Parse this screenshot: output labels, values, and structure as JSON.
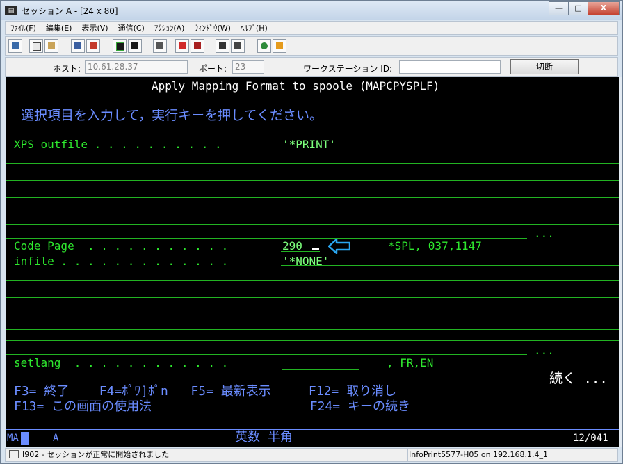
{
  "window": {
    "title": "セッション A - [24 x 80]",
    "buttons": {
      "minimize": "—",
      "maximize": "□",
      "close": "X"
    }
  },
  "menu": [
    "ﾌｧｲﾙ(F)",
    "編集(E)",
    "表示(V)",
    "通信(C)",
    "ｱｸｼｮﾝ(A)",
    "ｳｨﾝﾄﾞｳ(W)",
    "ﾍﾙﾌﾟ(H)"
  ],
  "toolbar_icons": [
    "print-screen-icon",
    "copy-icon",
    "paste-icon",
    "send-file-icon",
    "receive-file-icon",
    "display-icon",
    "keypad-icon",
    "macro-icon",
    "record-macro-icon",
    "stop-macro-icon",
    "play-macro-icon",
    "macro-list-icon",
    "network-icon",
    "support-icon"
  ],
  "connection": {
    "host_label": "ホスト:",
    "host_value": "10.61.28.37",
    "port_label": "ポート:",
    "port_value": "23",
    "ws_label": "ワークステーション ID:",
    "ws_value": "",
    "disconnect_label": "切断"
  },
  "terminal": {
    "title": "Apply Mapping Format to spoole (MAPCPYSPLF)",
    "instruction": "選択項目を入力して，実行キーを押してください。",
    "xps_label": "XPS outfile . . . . . . . . . .",
    "xps_value": "'*PRINT'",
    "more1": "...",
    "codepage_label": "Code Page  . . . . . . . . . . .",
    "codepage_value": "290",
    "codepage_hint": "*SPL, 037,1147",
    "infile_label": "infile . . . . . . . . . . . . .",
    "infile_value": "'*NONE'",
    "more2": "...",
    "setlang_label": "setlang  . . . . . . . . . . . .",
    "setlang_hint": ", FR,EN",
    "continue": "続く ...",
    "fkeys_row1": "F3= 終了    F4=ﾎﾟﾜ]ﾎﾟn   F5= 最新表示     F12= 取り消し",
    "fkeys_row2": "F13= この画面の使用法                     F24= キーの続き",
    "oia_left": "MA",
    "oia_mode": "A",
    "oia_input": "英数 半角",
    "oia_pos": "12/041"
  },
  "status": {
    "message": "I902 - セッションが正常に開始されました",
    "host": "InfoPrint5577-H05 on 192.168.1.4_1"
  }
}
